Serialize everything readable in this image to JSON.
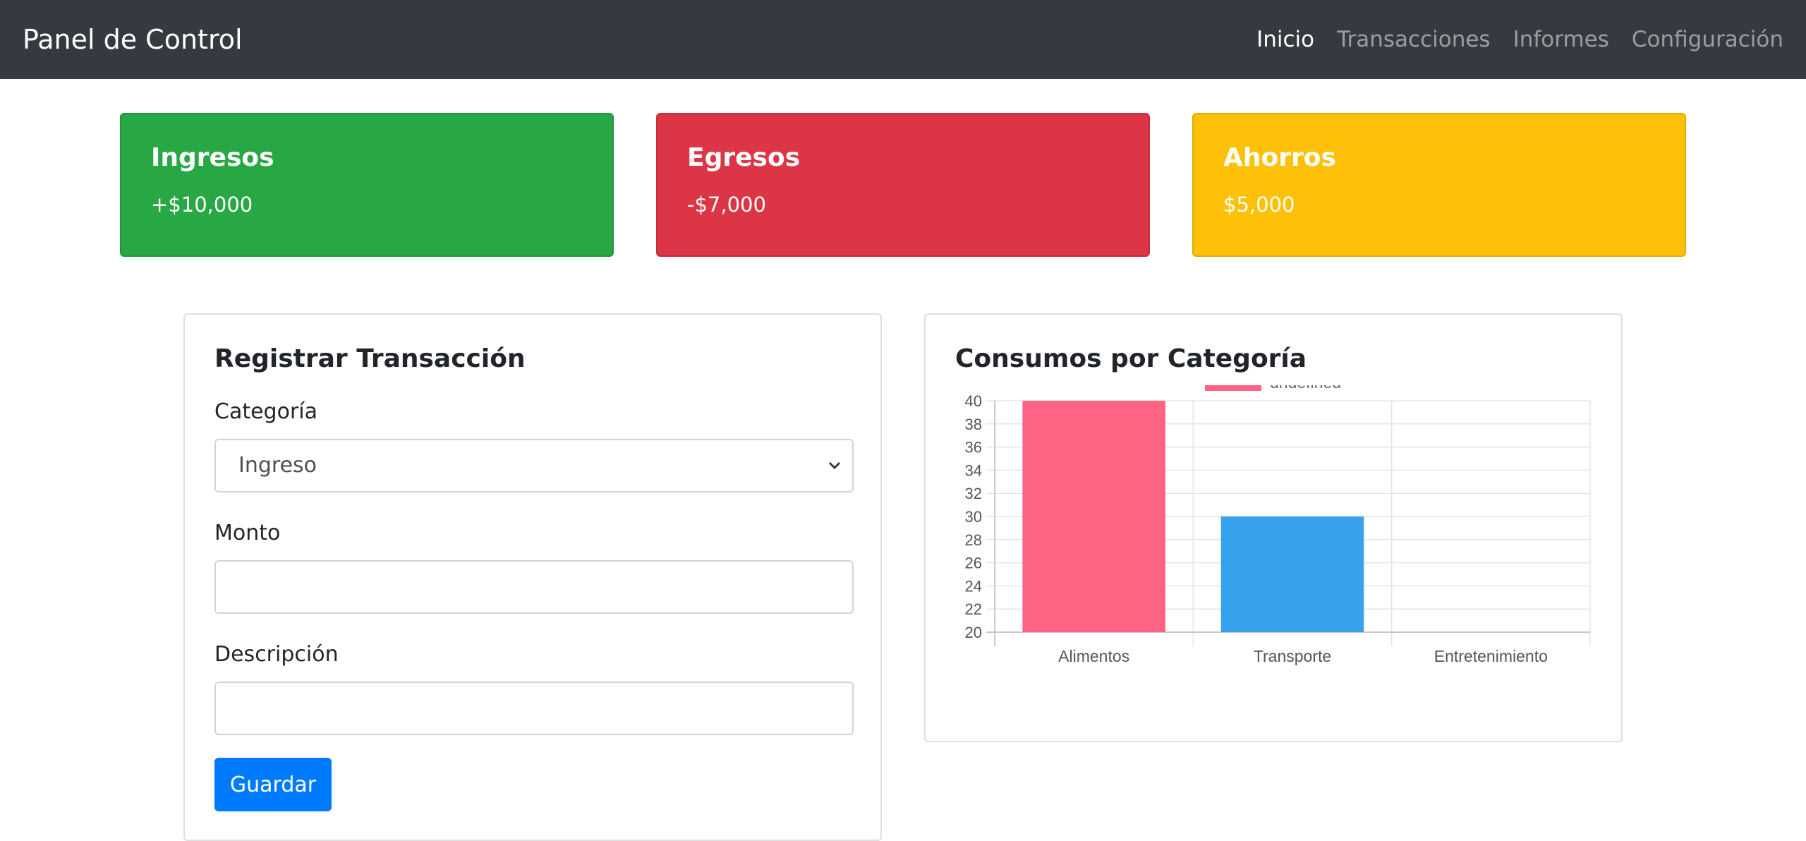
{
  "nav": {
    "brand": "Panel de Control",
    "items": [
      {
        "label": "Inicio",
        "active": true
      },
      {
        "label": "Transacciones",
        "active": false
      },
      {
        "label": "Informes",
        "active": false
      },
      {
        "label": "Configuración",
        "active": false
      }
    ]
  },
  "summary": [
    {
      "title": "Ingresos",
      "value": "+$10,000",
      "color": "#28a745"
    },
    {
      "title": "Egresos",
      "value": "-$7,000",
      "color": "#dc3545"
    },
    {
      "title": "Ahorros",
      "value": "$5,000",
      "color": "#ffc107"
    }
  ],
  "form": {
    "title": "Registrar Transacción",
    "category_label": "Categoría",
    "category_value": "Ingreso",
    "amount_label": "Monto",
    "amount_value": "",
    "description_label": "Descripción",
    "description_value": "",
    "save_label": "Guardar"
  },
  "chart_panel": {
    "title": "Consumos por Categoría"
  },
  "chart_data": {
    "type": "bar",
    "categories": [
      "Alimentos",
      "Transporte",
      "Entretenimiento"
    ],
    "values": [
      40,
      30,
      20
    ],
    "colors": [
      "#ff6384",
      "#36a2eb",
      "#ffce56"
    ],
    "legend": "undefined",
    "legend_color": "#ff6384",
    "ylim": [
      20,
      40
    ],
    "yticks": [
      40,
      38,
      36,
      34,
      32,
      30,
      28,
      26,
      24,
      22,
      20
    ],
    "grid": true,
    "legend_position": "top"
  }
}
